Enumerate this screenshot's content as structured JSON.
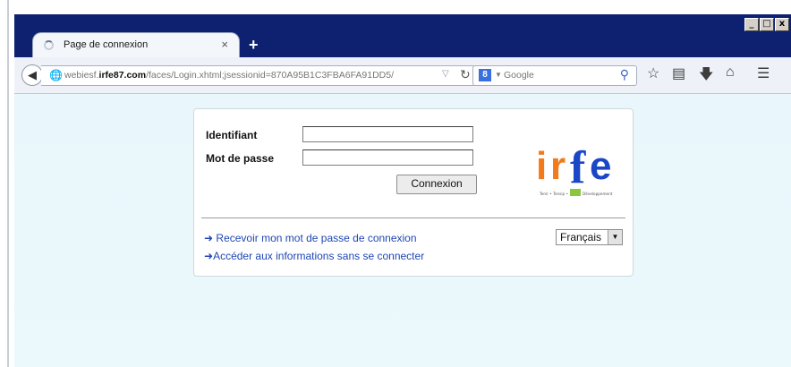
{
  "browser": {
    "tab_title": "Page de connexion",
    "tab_close": "×",
    "new_tab": "+",
    "url_prefix": "webiesf.",
    "url_domain": "irfe87.com",
    "url_rest": "/faces/Login.xhtml;jsessionid=870A95B1C3FBA6FA91DD5/",
    "search_engine_badge": "8",
    "search_placeholder": "Google",
    "window_controls": [
      "_",
      "□",
      "x"
    ],
    "icons": [
      "back-arrow-icon",
      "globe-icon",
      "reload-icon",
      "search-icon",
      "star-icon",
      "clipboard-icon",
      "download-icon",
      "home-icon",
      "menu-icon"
    ]
  },
  "login": {
    "username_label": "Identifiant",
    "password_label": "Mot de passe",
    "username_value": "",
    "password_value": "",
    "submit_label": "Connexion",
    "logo_text": "irfe",
    "logo_tagline": "Tenir • Tensip • Développement",
    "link_password": "Recevoir mon mot de passe de connexion",
    "link_no_login": "Accéder aux informations sans se connecter",
    "language": "Français"
  },
  "colors": {
    "titlebar": "#0d2170",
    "logo_orange": "#f07a1c",
    "logo_blue": "#1a47c6",
    "link": "#1f47b5",
    "page_bg": "#e9f6fb"
  }
}
